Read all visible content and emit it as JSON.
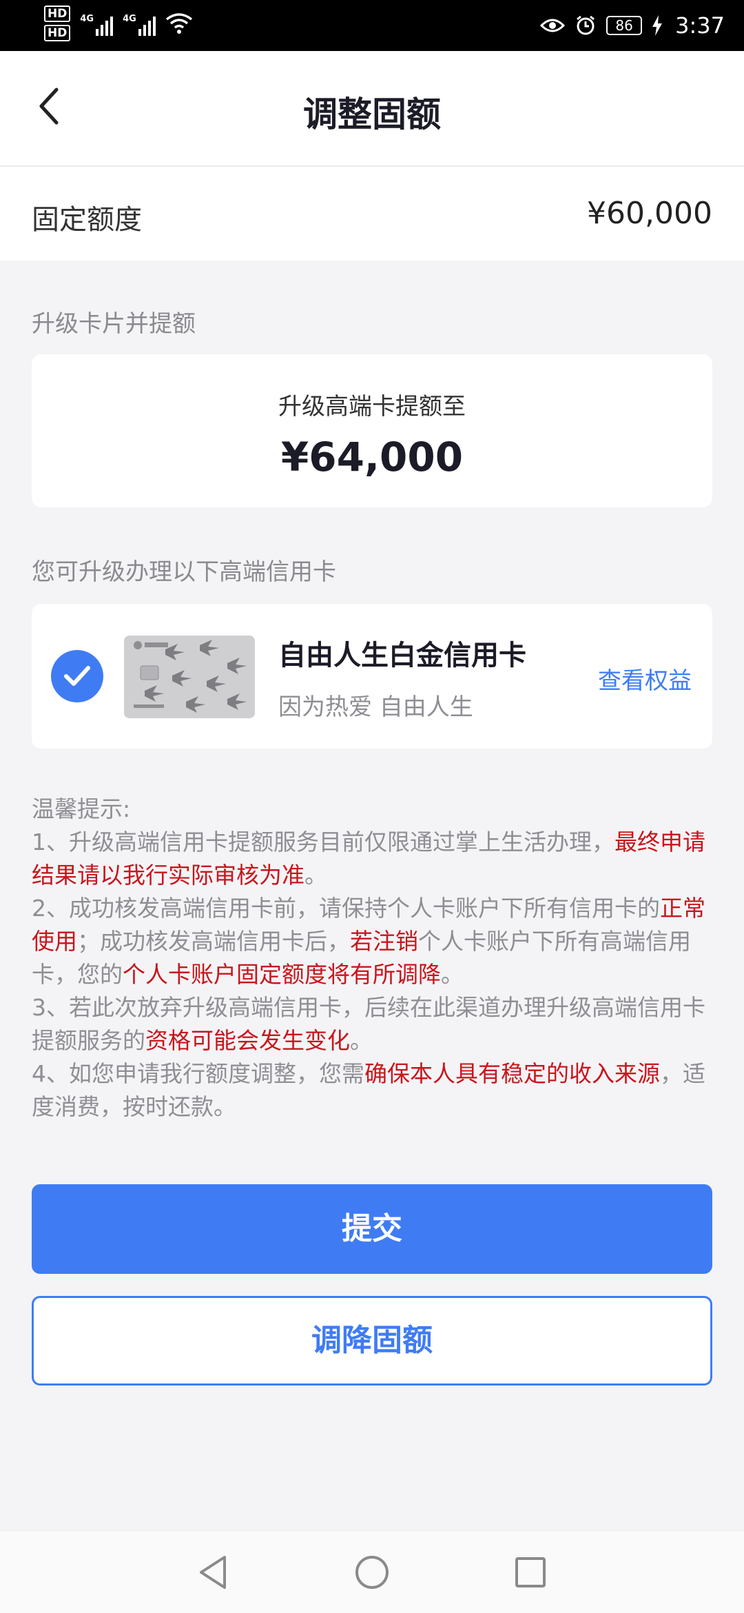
{
  "status_bar": {
    "hd1": "HD",
    "hd2": "HD",
    "net1": "4G",
    "net2": "4G",
    "battery": "86",
    "time": "3:37"
  },
  "header": {
    "title": "调整固额",
    "back_icon": "chevron-left-icon"
  },
  "quota": {
    "label": "固定额度",
    "value": "¥60,000"
  },
  "upgrade_section": {
    "label": "升级卡片并提额",
    "subtitle": "升级高端卡提额至",
    "amount": "¥64,000"
  },
  "cards_section": {
    "label": "您可升级办理以下高端信用卡",
    "card": {
      "name": "自由人生白金信用卡",
      "slogan": "因为热爱 自由人生",
      "link": "查看权益",
      "checked": true
    }
  },
  "tips": {
    "heading": "温馨提示:",
    "t1_a": "1、升级高端信用卡提额服务目前仅限通过掌上生活办理，",
    "t1_b": "最终申请结果请以我行实际审核为准",
    "t1_c": "。",
    "t2_a": "2、成功核发高端信用卡前，请保持个人卡账户下所有信用卡的",
    "t2_b": "正常使用",
    "t2_c": "；成功核发高端信用卡后，",
    "t2_d": "若注销",
    "t2_e": "个人卡账户下所有高端信用卡，您的",
    "t2_f": "个人卡账户固定额度将有所调降",
    "t2_g": "。",
    "t3_a": "3、若此次放弃升级高端信用卡，后续在此渠道办理升级高端信用卡提额服务的",
    "t3_b": "资格可能会发生变化",
    "t3_c": "。",
    "t4_a": "4、如您申请我行额度调整，您需",
    "t4_b": "确保本人具有稳定的收入来源",
    "t4_c": "，适度消费，按时还款。"
  },
  "buttons": {
    "submit": "提交",
    "reduce": "调降固额"
  },
  "colors": {
    "accent": "#3f7cf4",
    "warning": "#c8161d"
  }
}
